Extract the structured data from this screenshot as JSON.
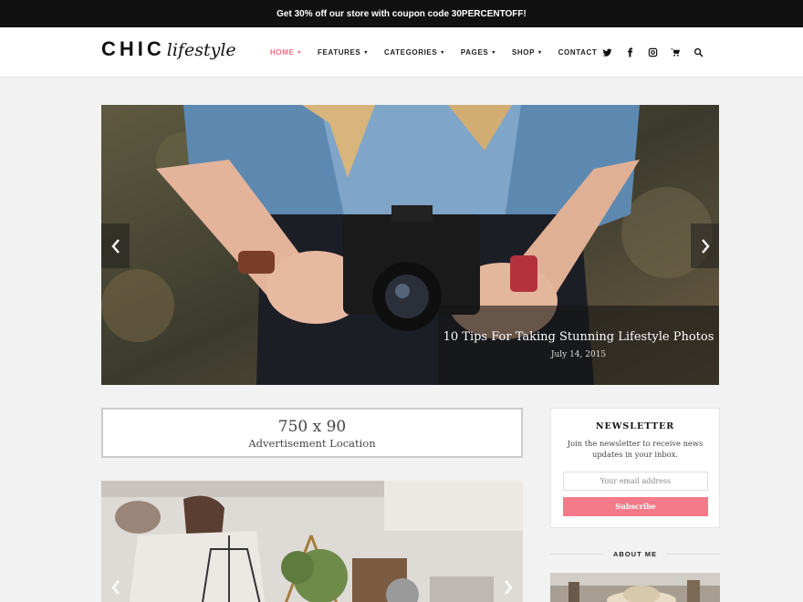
{
  "promo": {
    "text": "Get 30% off our store with coupon code 30PERCENTOFF!"
  },
  "logo": {
    "main": "CHIC",
    "sub": "lifestyle"
  },
  "nav": {
    "items": [
      {
        "label": "HOME",
        "active": true,
        "dropdown": true
      },
      {
        "label": "FEATURES",
        "active": false,
        "dropdown": true
      },
      {
        "label": "CATEGORIES",
        "active": false,
        "dropdown": true
      },
      {
        "label": "PAGES",
        "active": false,
        "dropdown": true
      },
      {
        "label": "SHOP",
        "active": false,
        "dropdown": true
      },
      {
        "label": "CONTACT",
        "active": false,
        "dropdown": false
      }
    ],
    "caret": "▾"
  },
  "social": [
    "twitter-icon",
    "facebook-icon",
    "instagram-icon",
    "cart-icon",
    "search-icon"
  ],
  "slider": {
    "title": "10 Tips For Taking Stunning Lifestyle Photos",
    "date": "July 14, 2015",
    "prev": "‹",
    "next": "›"
  },
  "ad": {
    "size": "750 x 90",
    "label": "Advertisement Location"
  },
  "newsletter": {
    "title": "NEWSLETTER",
    "text": "Join the newsletter to receive news updates in your inbox.",
    "placeholder": "Your email address",
    "button": "Subscribe"
  },
  "about": {
    "title": "ABOUT ME"
  },
  "colors": {
    "accent": "#f26c80",
    "subscribe": "#f47989",
    "topbar": "#111111"
  }
}
